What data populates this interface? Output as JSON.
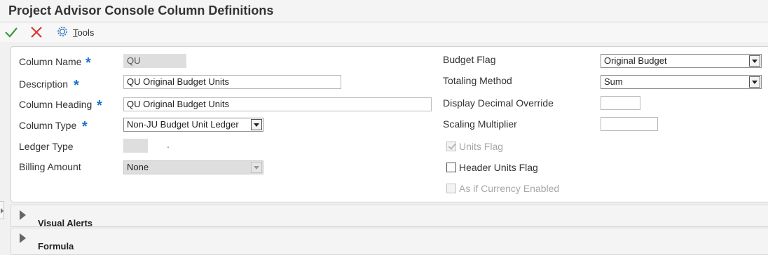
{
  "title": "Project Advisor Console Column Definitions",
  "toolbar": {
    "ok_icon": "checkmark-icon",
    "cancel_icon": "x-icon",
    "tools_icon": "gear-icon",
    "tools_hotkey": "T",
    "tools_rest": "ools"
  },
  "form": {
    "column_name": {
      "label": "Column Name",
      "value": "QU",
      "required": true
    },
    "description": {
      "label": "Description",
      "value": "QU Original Budget Units",
      "required": true
    },
    "column_heading": {
      "label": "Column Heading",
      "value": "QU Original Budget Units",
      "required": true
    },
    "column_type": {
      "label": "Column Type",
      "value": "Non-JU Budget Unit Ledger",
      "required": true
    },
    "ledger_type": {
      "label": "Ledger Type",
      "value": "",
      "suffix": "."
    },
    "billing_amount": {
      "label": "Billing Amount",
      "value": "None"
    },
    "budget_flag": {
      "label": "Budget Flag",
      "value": "Original Budget"
    },
    "totaling_method": {
      "label": "Totaling Method",
      "value": "Sum"
    },
    "display_decimal_override": {
      "label": "Display Decimal Override",
      "value": ""
    },
    "scaling_multiplier": {
      "label": "Scaling Multiplier",
      "value": ""
    },
    "units_flag": {
      "label": "Units Flag",
      "checked": true,
      "disabled": true
    },
    "header_units_flag": {
      "label": "Header Units Flag",
      "checked": false,
      "disabled": false
    },
    "as_if_currency": {
      "label": "As if Currency Enabled",
      "checked": false,
      "disabled": true
    },
    "required_marker": "*"
  },
  "sections": [
    {
      "label": "Visual Alerts",
      "expanded": false
    },
    {
      "label": "Formula",
      "expanded": false
    }
  ],
  "colors": {
    "accent": "#1a73c9",
    "ok": "#3c9a3c",
    "cancel": "#d63a3a"
  }
}
